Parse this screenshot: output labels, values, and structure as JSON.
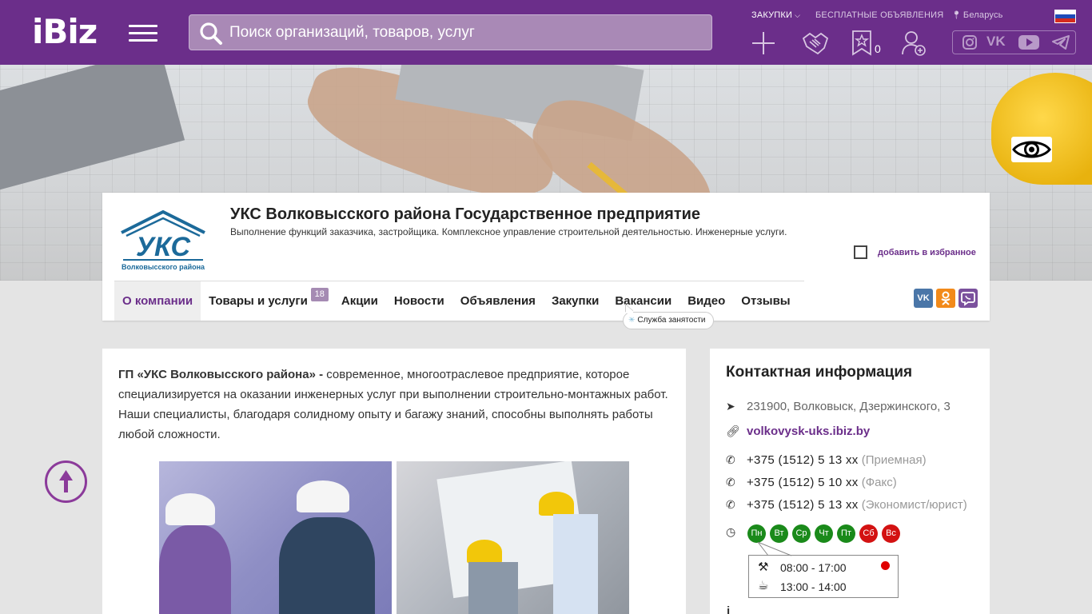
{
  "header": {
    "logo": "iBiz",
    "search_placeholder": "Поиск организаций, товаров, услуг",
    "purchases_label": "ЗАКУПКИ",
    "free_ads_label": "БЕСПЛАТНЫЕ ОБЪЯВЛЕНИЯ",
    "region_label": "Беларусь",
    "favorites_count": "0",
    "social_icons": [
      "instagram-icon",
      "vk-icon",
      "youtube-icon",
      "telegram-icon"
    ]
  },
  "company": {
    "logo_text": "УКС",
    "logo_subtext": "Волковысского района",
    "title": "УКС Волковысского района Государственное предприятие",
    "description": "Выполнение функций заказчика, застройщика. Комплексное управление строительной деятельностью. Инженерные услуги.",
    "favorite_label": "добавить в избранное",
    "tabs": [
      {
        "label": "О компании",
        "active": true
      },
      {
        "label": "Товары и услуги",
        "badge": "18"
      },
      {
        "label": "Акции"
      },
      {
        "label": "Новости"
      },
      {
        "label": "Объявления"
      },
      {
        "label": "Закупки"
      },
      {
        "label": "Вакансии"
      },
      {
        "label": "Видео"
      },
      {
        "label": "Отзывы"
      }
    ],
    "employment_service": "Служба занятости",
    "share_icons": [
      "vk-share-icon",
      "odnoklassniki-share-icon",
      "viber-share-icon"
    ]
  },
  "about": {
    "lead_bold": "ГП «УКС Волковысского района» -",
    "text": " современное, многоотраслевое предприятие, которое специализируется на оказании инженерных услуг при выполнении строительно-монтажных работ. Наши специалисты, благодаря солидному опыту и багажу знаний, способны выполнять работы любой сложности."
  },
  "contact": {
    "title": "Контактная информация",
    "address": "231900, Волковыск, Дзержинского, 3",
    "website": "volkovysk-uks.ibiz.by",
    "phones": [
      {
        "number": "+375 (1512) 5 13 хх",
        "note": "(Приемная)"
      },
      {
        "number": "+375 (1512) 5 10 хх",
        "note": "(Факс)"
      },
      {
        "number": "+375 (1512) 5 13 хх",
        "note": "(Экономист/юрист)"
      }
    ],
    "days": [
      {
        "label": "Пн",
        "open": true
      },
      {
        "label": "Вт",
        "open": true
      },
      {
        "label": "Ср",
        "open": true
      },
      {
        "label": "Чт",
        "open": true
      },
      {
        "label": "Пт",
        "open": true
      },
      {
        "label": "Сб",
        "open": false
      },
      {
        "label": "Вс",
        "open": false
      }
    ],
    "work_hours": "08:00 - 17:00",
    "lunch_hours": "13:00 - 14:00"
  },
  "colors": {
    "brand": "#6b2e8a",
    "open_day": "#1a8a1a",
    "closed_day": "#d31212"
  }
}
